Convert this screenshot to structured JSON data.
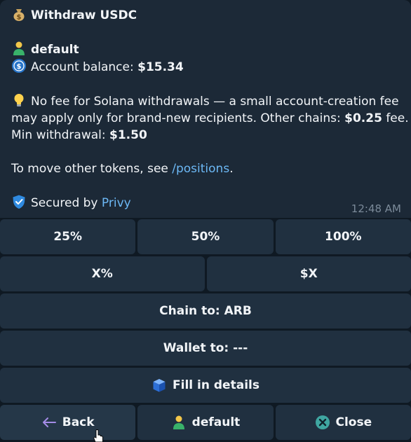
{
  "message": {
    "title": "Withdraw USDC",
    "wallet_name": "default",
    "balance_label": "Account balance: ",
    "balance_value": "$15.34",
    "fee_line1": "No fee for Solana withdrawals — a small account-creation fee",
    "fee_line2_a": "may apply only for brand-new recipients. Other chains: ",
    "fee_line2_value": "$0.25",
    "fee_line2_b": " fee.",
    "min_label": "Min withdrawal: ",
    "min_value": "$1.50",
    "tokens_a": "To move other tokens, see ",
    "tokens_link": "/positions",
    "tokens_b": ".",
    "secured_a": "Secured by ",
    "secured_link": "Privy",
    "time": "12:48 AM"
  },
  "keyboard": {
    "pct25": "25%",
    "pct50": "50%",
    "pct100": "100%",
    "xpct": "X%",
    "xusd": "$X",
    "chain": "Chain to: ARB",
    "wallet": "Wallet to: ---",
    "fill": "Fill in details",
    "back": "Back",
    "default": "default",
    "close": "Close"
  },
  "icons": {
    "title": "money-bag-icon",
    "wallet": "person-icon",
    "balance": "usdc-coin-icon",
    "fee": "light-bulb-icon",
    "secured": "shield-icon",
    "fill": "blue-box-icon",
    "back": "left-arrow-icon",
    "default": "person-icon",
    "close": "cross-circle-icon"
  },
  "colors": {
    "link": "#6cb8f5",
    "bubble": "#1c2937",
    "button": "#203040"
  }
}
